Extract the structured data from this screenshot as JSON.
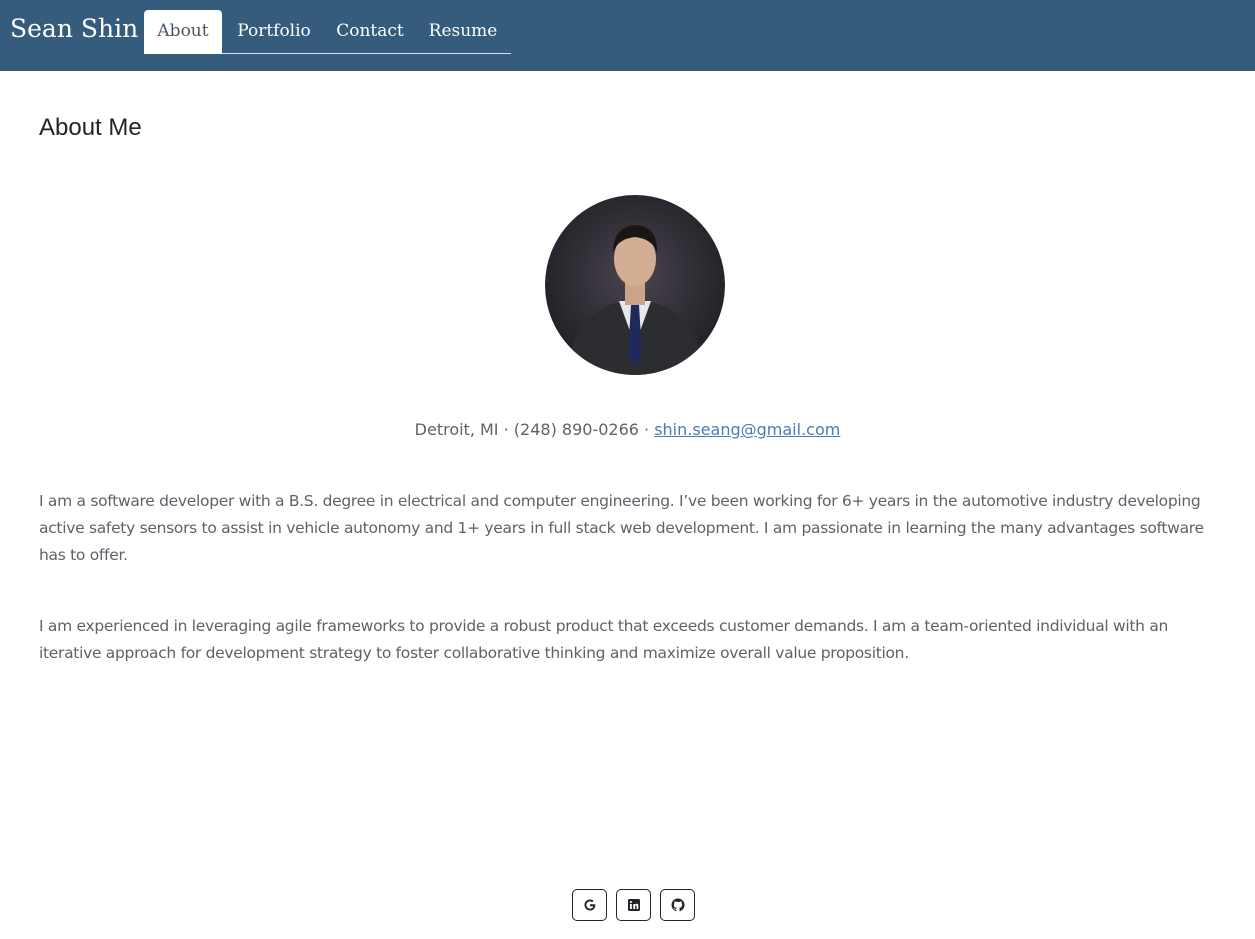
{
  "nav": {
    "brand": "Sean Shin",
    "tabs": [
      {
        "label": "About",
        "active": true
      },
      {
        "label": "Portfolio",
        "active": false
      },
      {
        "label": "Contact",
        "active": false
      },
      {
        "label": "Resume",
        "active": false
      }
    ]
  },
  "main": {
    "heading": "About Me",
    "contact": {
      "location": "Detroit, MI",
      "separator": " · ",
      "phone": "(248) 890-0266",
      "email": " shin.seang@gmail.com"
    },
    "paragraphs": [
      "I am a software developer with a B.S. degree in electrical and computer engineering. I’ve been working for 6+ years in the automotive industry developing active safety sensors to assist in vehicle autonomy and 1+ years in full stack web development. I am passionate in learning the many advantages software has to offer.",
      "I am experienced in leveraging agile frameworks to provide a robust product that exceeds customer demands. I am a team-oriented individual with an iterative approach for development strategy to foster collaborative thinking and maximize overall value proposition."
    ]
  },
  "footer": {
    "social_icons": [
      "google-icon",
      "linkedin-icon",
      "github-icon"
    ]
  },
  "colors": {
    "navbar": "#355c7d",
    "link": "#4b7bb8",
    "body_text": "#5c636a"
  }
}
